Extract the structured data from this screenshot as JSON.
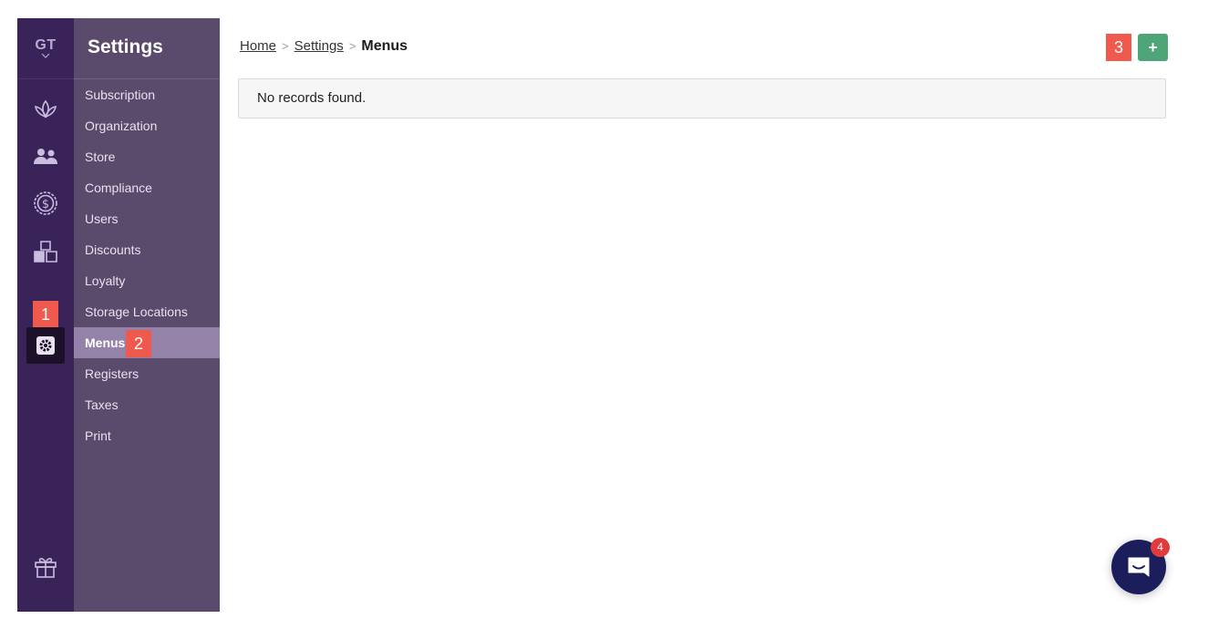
{
  "rail": {
    "org_initials": "GT",
    "markers": {
      "m1": "1"
    }
  },
  "nav": {
    "title": "Settings",
    "items": [
      {
        "label": "Subscription"
      },
      {
        "label": "Organization"
      },
      {
        "label": "Store"
      },
      {
        "label": "Compliance"
      },
      {
        "label": "Users"
      },
      {
        "label": "Discounts"
      },
      {
        "label": "Loyalty"
      },
      {
        "label": "Storage Locations"
      },
      {
        "label": "Menus",
        "active": true
      },
      {
        "label": "Registers"
      },
      {
        "label": "Taxes"
      },
      {
        "label": "Print"
      }
    ],
    "markers": {
      "m2": "2"
    }
  },
  "breadcrumb": {
    "home": "Home",
    "settings": "Settings",
    "current": "Menus"
  },
  "toolbar": {
    "marker": "3",
    "add_label": "+"
  },
  "main": {
    "empty_message": "No records found."
  },
  "chat": {
    "badge_count": "4"
  },
  "colors": {
    "rail_bg": "#3a2358",
    "nav_bg": "#5a4a6c",
    "nav_active_bg": "#9482a8",
    "add_button": "#4ea577",
    "marker": "#f05a4e",
    "chat_bg": "#1c1e5c",
    "badge": "#e23b3b"
  }
}
